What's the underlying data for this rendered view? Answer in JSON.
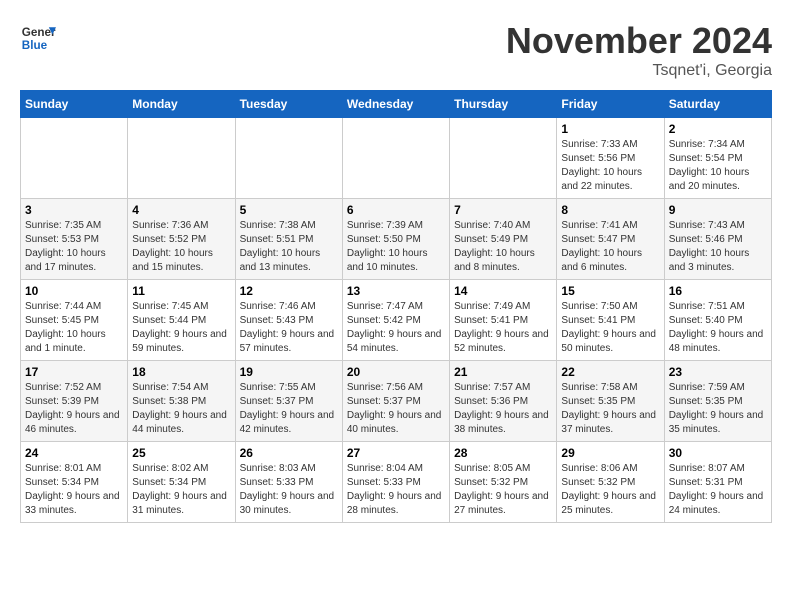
{
  "logo": {
    "line1": "General",
    "line2": "Blue"
  },
  "title": "November 2024",
  "subtitle": "Tsqnet'i, Georgia",
  "days_header": [
    "Sunday",
    "Monday",
    "Tuesday",
    "Wednesday",
    "Thursday",
    "Friday",
    "Saturday"
  ],
  "weeks": [
    [
      {
        "day": "",
        "info": ""
      },
      {
        "day": "",
        "info": ""
      },
      {
        "day": "",
        "info": ""
      },
      {
        "day": "",
        "info": ""
      },
      {
        "day": "",
        "info": ""
      },
      {
        "day": "1",
        "info": "Sunrise: 7:33 AM\nSunset: 5:56 PM\nDaylight: 10 hours and 22 minutes."
      },
      {
        "day": "2",
        "info": "Sunrise: 7:34 AM\nSunset: 5:54 PM\nDaylight: 10 hours and 20 minutes."
      }
    ],
    [
      {
        "day": "3",
        "info": "Sunrise: 7:35 AM\nSunset: 5:53 PM\nDaylight: 10 hours and 17 minutes."
      },
      {
        "day": "4",
        "info": "Sunrise: 7:36 AM\nSunset: 5:52 PM\nDaylight: 10 hours and 15 minutes."
      },
      {
        "day": "5",
        "info": "Sunrise: 7:38 AM\nSunset: 5:51 PM\nDaylight: 10 hours and 13 minutes."
      },
      {
        "day": "6",
        "info": "Sunrise: 7:39 AM\nSunset: 5:50 PM\nDaylight: 10 hours and 10 minutes."
      },
      {
        "day": "7",
        "info": "Sunrise: 7:40 AM\nSunset: 5:49 PM\nDaylight: 10 hours and 8 minutes."
      },
      {
        "day": "8",
        "info": "Sunrise: 7:41 AM\nSunset: 5:47 PM\nDaylight: 10 hours and 6 minutes."
      },
      {
        "day": "9",
        "info": "Sunrise: 7:43 AM\nSunset: 5:46 PM\nDaylight: 10 hours and 3 minutes."
      }
    ],
    [
      {
        "day": "10",
        "info": "Sunrise: 7:44 AM\nSunset: 5:45 PM\nDaylight: 10 hours and 1 minute."
      },
      {
        "day": "11",
        "info": "Sunrise: 7:45 AM\nSunset: 5:44 PM\nDaylight: 9 hours and 59 minutes."
      },
      {
        "day": "12",
        "info": "Sunrise: 7:46 AM\nSunset: 5:43 PM\nDaylight: 9 hours and 57 minutes."
      },
      {
        "day": "13",
        "info": "Sunrise: 7:47 AM\nSunset: 5:42 PM\nDaylight: 9 hours and 54 minutes."
      },
      {
        "day": "14",
        "info": "Sunrise: 7:49 AM\nSunset: 5:41 PM\nDaylight: 9 hours and 52 minutes."
      },
      {
        "day": "15",
        "info": "Sunrise: 7:50 AM\nSunset: 5:41 PM\nDaylight: 9 hours and 50 minutes."
      },
      {
        "day": "16",
        "info": "Sunrise: 7:51 AM\nSunset: 5:40 PM\nDaylight: 9 hours and 48 minutes."
      }
    ],
    [
      {
        "day": "17",
        "info": "Sunrise: 7:52 AM\nSunset: 5:39 PM\nDaylight: 9 hours and 46 minutes."
      },
      {
        "day": "18",
        "info": "Sunrise: 7:54 AM\nSunset: 5:38 PM\nDaylight: 9 hours and 44 minutes."
      },
      {
        "day": "19",
        "info": "Sunrise: 7:55 AM\nSunset: 5:37 PM\nDaylight: 9 hours and 42 minutes."
      },
      {
        "day": "20",
        "info": "Sunrise: 7:56 AM\nSunset: 5:37 PM\nDaylight: 9 hours and 40 minutes."
      },
      {
        "day": "21",
        "info": "Sunrise: 7:57 AM\nSunset: 5:36 PM\nDaylight: 9 hours and 38 minutes."
      },
      {
        "day": "22",
        "info": "Sunrise: 7:58 AM\nSunset: 5:35 PM\nDaylight: 9 hours and 37 minutes."
      },
      {
        "day": "23",
        "info": "Sunrise: 7:59 AM\nSunset: 5:35 PM\nDaylight: 9 hours and 35 minutes."
      }
    ],
    [
      {
        "day": "24",
        "info": "Sunrise: 8:01 AM\nSunset: 5:34 PM\nDaylight: 9 hours and 33 minutes."
      },
      {
        "day": "25",
        "info": "Sunrise: 8:02 AM\nSunset: 5:34 PM\nDaylight: 9 hours and 31 minutes."
      },
      {
        "day": "26",
        "info": "Sunrise: 8:03 AM\nSunset: 5:33 PM\nDaylight: 9 hours and 30 minutes."
      },
      {
        "day": "27",
        "info": "Sunrise: 8:04 AM\nSunset: 5:33 PM\nDaylight: 9 hours and 28 minutes."
      },
      {
        "day": "28",
        "info": "Sunrise: 8:05 AM\nSunset: 5:32 PM\nDaylight: 9 hours and 27 minutes."
      },
      {
        "day": "29",
        "info": "Sunrise: 8:06 AM\nSunset: 5:32 PM\nDaylight: 9 hours and 25 minutes."
      },
      {
        "day": "30",
        "info": "Sunrise: 8:07 AM\nSunset: 5:31 PM\nDaylight: 9 hours and 24 minutes."
      }
    ]
  ]
}
